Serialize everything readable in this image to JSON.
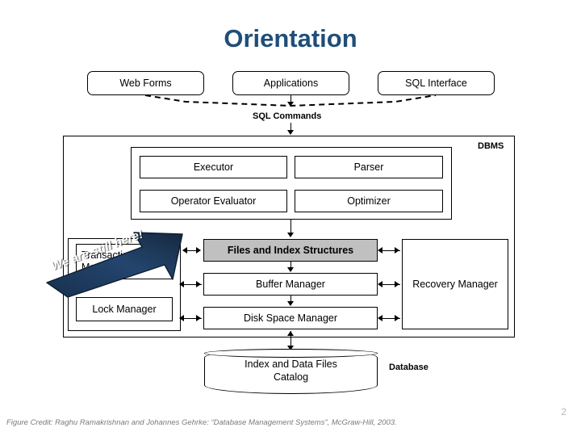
{
  "slide": {
    "title": "Orientation",
    "page_number": "2",
    "credit": "Figure Credit: Raghu Ramakrishnan and Johannes Gehrke: “Database Management Systems”, McGraw-Hill, 2003.",
    "title_color": "#1F4E79"
  },
  "top_row": {
    "items": [
      {
        "label": "Web Forms"
      },
      {
        "label": "Applications"
      },
      {
        "label": "SQL Interface"
      }
    ]
  },
  "connector_labels": {
    "sql_commands": "SQL Commands",
    "dbms": "DBMS",
    "database": "Database"
  },
  "query_processing": {
    "boxes": [
      {
        "label": "Executor"
      },
      {
        "label": "Parser"
      },
      {
        "label": "Operator Evaluator"
      },
      {
        "label": "Optimizer"
      }
    ]
  },
  "transaction_group": {
    "boxes": [
      {
        "label": "Transaction Manager"
      },
      {
        "label": "Lock Manager"
      }
    ]
  },
  "storage_column": {
    "boxes": [
      {
        "label": "Files and Index Structures",
        "highlight_color": "#C0C0C0",
        "highlighted": true
      },
      {
        "label": "Buffer Manager",
        "highlighted": false
      },
      {
        "label": "Disk Space Manager",
        "highlighted": false
      }
    ]
  },
  "recovery": {
    "label": "Recovery Manager"
  },
  "database_store": {
    "line1": "Index and Data Files",
    "line2": "Catalog"
  },
  "banner": {
    "text": "We are still here!",
    "fill_color": "#1F3A5F",
    "text_color": "#FFFFFF"
  }
}
